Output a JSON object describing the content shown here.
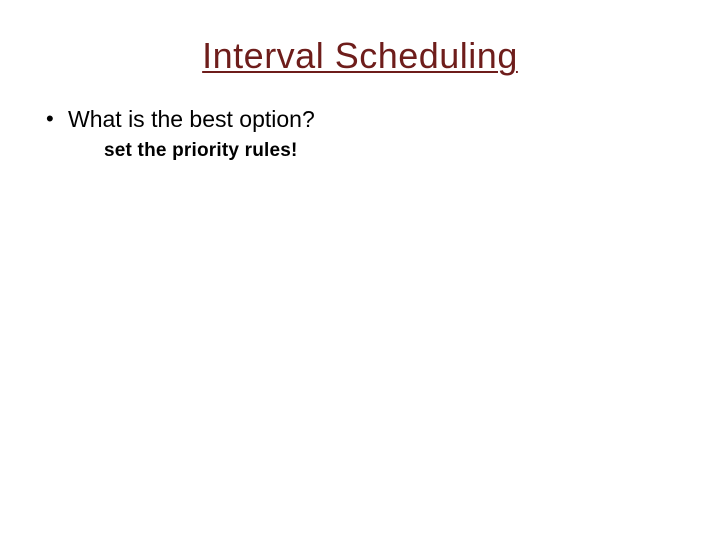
{
  "slide": {
    "title": "Interval Scheduling",
    "bullets": [
      {
        "text": "What is the best option?",
        "sub": "set the priority rules!"
      }
    ]
  }
}
